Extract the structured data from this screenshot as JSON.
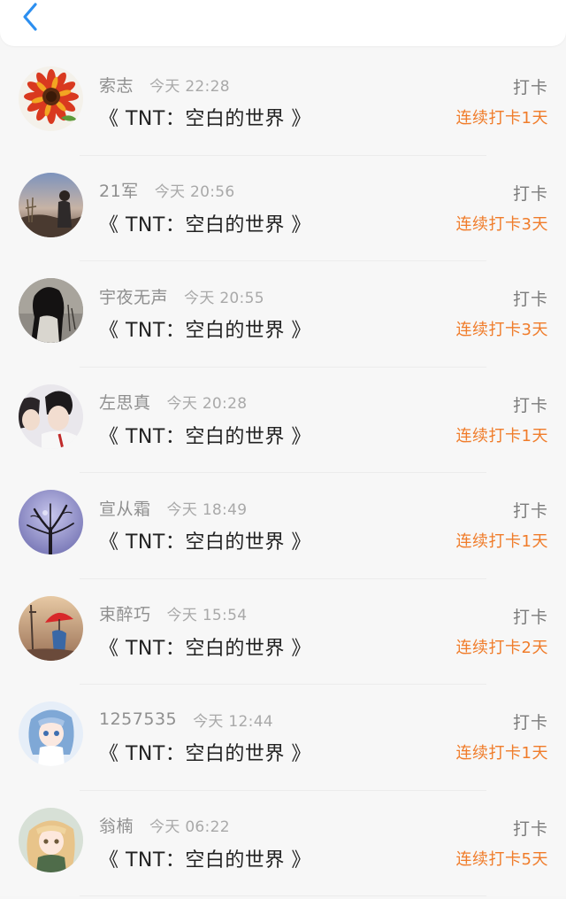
{
  "header": {
    "back_icon": "chevron-left-icon",
    "accent_color": "#2c8ff0"
  },
  "checkins": [
    {
      "name": "索志",
      "time": "今天 22:28",
      "title": "《 TNT：空白的世界 》",
      "action": "打卡",
      "streak": "连续打卡1天",
      "avatar": "sunflower-avatar"
    },
    {
      "name": "21军",
      "time": "今天 20:56",
      "title": "《 TNT：空白的世界 》",
      "action": "打卡",
      "streak": "连续打卡3天",
      "avatar": "sunset-figure-avatar"
    },
    {
      "name": "宇夜无声",
      "time": "今天 20:55",
      "title": "《 TNT：空白的世界 》",
      "action": "打卡",
      "streak": "连续打卡3天",
      "avatar": "dark-hair-avatar"
    },
    {
      "name": "左思真",
      "time": "今天 20:28",
      "title": "《 TNT：空白的世界 》",
      "action": "打卡",
      "streak": "连续打卡1天",
      "avatar": "couple-avatar"
    },
    {
      "name": "宣从霜",
      "time": "今天 18:49",
      "title": "《 TNT：空白的世界 》",
      "action": "打卡",
      "streak": "连续打卡1天",
      "avatar": "bare-tree-avatar"
    },
    {
      "name": "束醉巧",
      "time": "今天 15:54",
      "title": "《 TNT：空白的世界 》",
      "action": "打卡",
      "streak": "连续打卡2天",
      "avatar": "red-umbrella-avatar"
    },
    {
      "name": "1257535",
      "time": "今天 12:44",
      "title": "《 TNT：空白的世界 》",
      "action": "打卡",
      "streak": "连续打卡1天",
      "avatar": "anime-blue-avatar"
    },
    {
      "name": "翁楠",
      "time": "今天 06:22",
      "title": "《 TNT：空白的世界 》",
      "action": "打卡",
      "streak": "连续打卡5天",
      "avatar": "anime-girl-avatar"
    }
  ],
  "colors": {
    "streak": "#f07c2a",
    "name": "#8f8f8f",
    "title": "#222222"
  }
}
